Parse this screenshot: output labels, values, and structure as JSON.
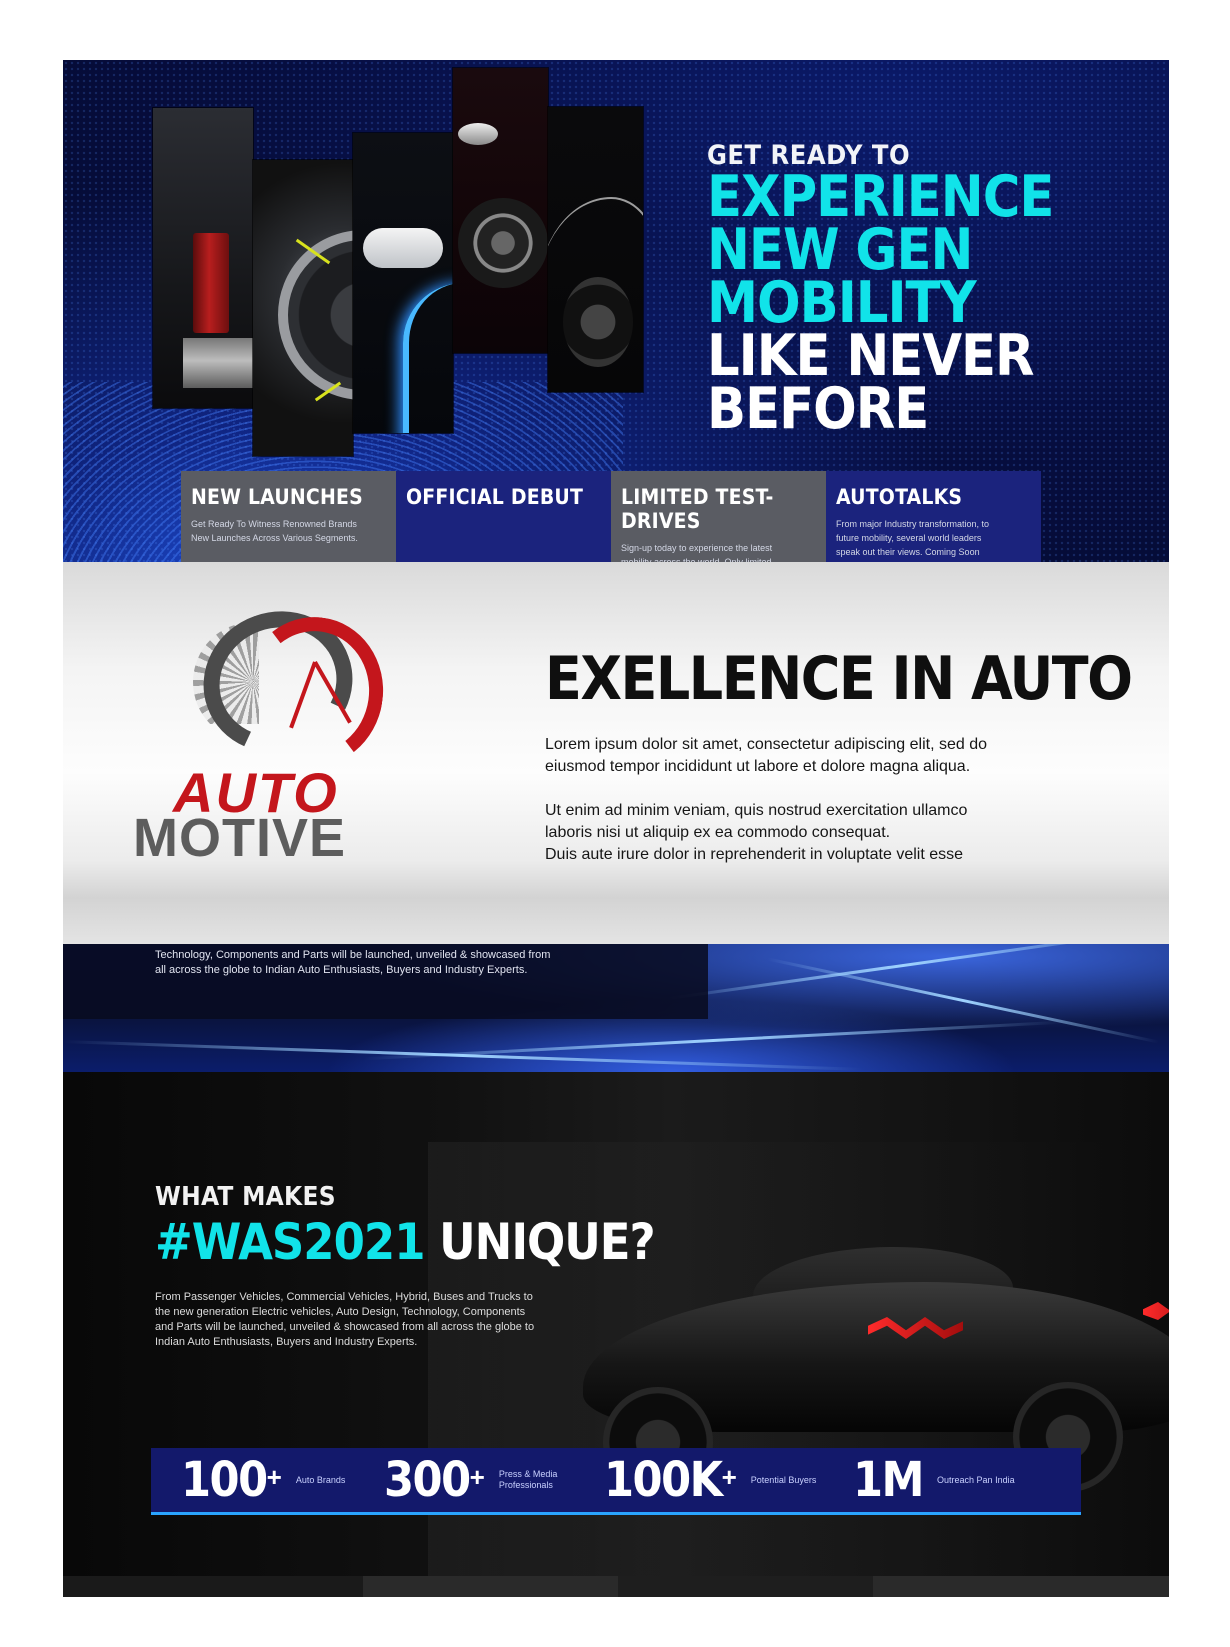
{
  "hero": {
    "kicker": "GET READY TO",
    "line1": "EXPERIENCE",
    "line2": "NEW GEN MOBILITY",
    "line3": "LIKE NEVER BEFORE",
    "features": [
      {
        "title": "NEW LAUNCHES",
        "desc": "Get Ready To Witness Renowned Brands\nNew Launches Across Various Segments."
      },
      {
        "title": "OFFICIAL DEBUT",
        "desc": ""
      },
      {
        "title": "LIMITED TEST-DRIVES",
        "desc": "Sign-up today to experience the latest\nmobility across the world. Only limited\nTest-Drives available."
      },
      {
        "title": "AUTOTALKS",
        "desc": "From major Industry transformation, to\nfuture mobility, several world leaders\nspeak out their views. Coming Soon"
      }
    ]
  },
  "excellence": {
    "logo_line1": "AUTO",
    "logo_line2": "MOTIVE",
    "title": "EXELLENCE IN AUTO",
    "para1": "Lorem ipsum dolor sit amet, consectetur adipiscing elit, sed do\n eiusmod tempor incididunt ut labore et dolore magna aliqua.",
    "para2": "Ut enim ad minim veniam, quis nostrud exercitation ullamco\nlaboris nisi ut aliquip ex ea commodo consequat.\nDuis aute irure dolor in reprehenderit in voluptate velit esse"
  },
  "city": {
    "text": "Technology, Components and Parts will be launched, unveiled & showcased from all across the globe to Indian Auto Enthusiasts, Buyers and Industry Experts."
  },
  "unique": {
    "kicker": "WHAT MAKES",
    "hashtag": "#WAS2021",
    "title_rest": " UNIQUE?",
    "body": "From Passenger Vehicles, Commercial Vehicles, Hybrid, Buses and Trucks to the new generation Electric vehicles, Auto Design, Technology, Components and Parts will be launched, unveiled & showcased from all across the globe to Indian Auto Enthusiasts, Buyers and Industry Experts.",
    "stats": [
      {
        "num": "100",
        "plus": "+",
        "label": "Auto Brands"
      },
      {
        "num": "300",
        "plus": "+",
        "label": "Press & Media\nProfessionals"
      },
      {
        "num": "100K",
        "plus": "+",
        "label": "Potential Buyers"
      },
      {
        "num": "1M",
        "plus": "",
        "label": "Outreach Pan India"
      }
    ]
  },
  "colors": {
    "accent_cyan": "#11e3e9",
    "navy": "#1b237d",
    "brand_red": "#c4161c",
    "stat_underline": "#2aa4ff"
  }
}
